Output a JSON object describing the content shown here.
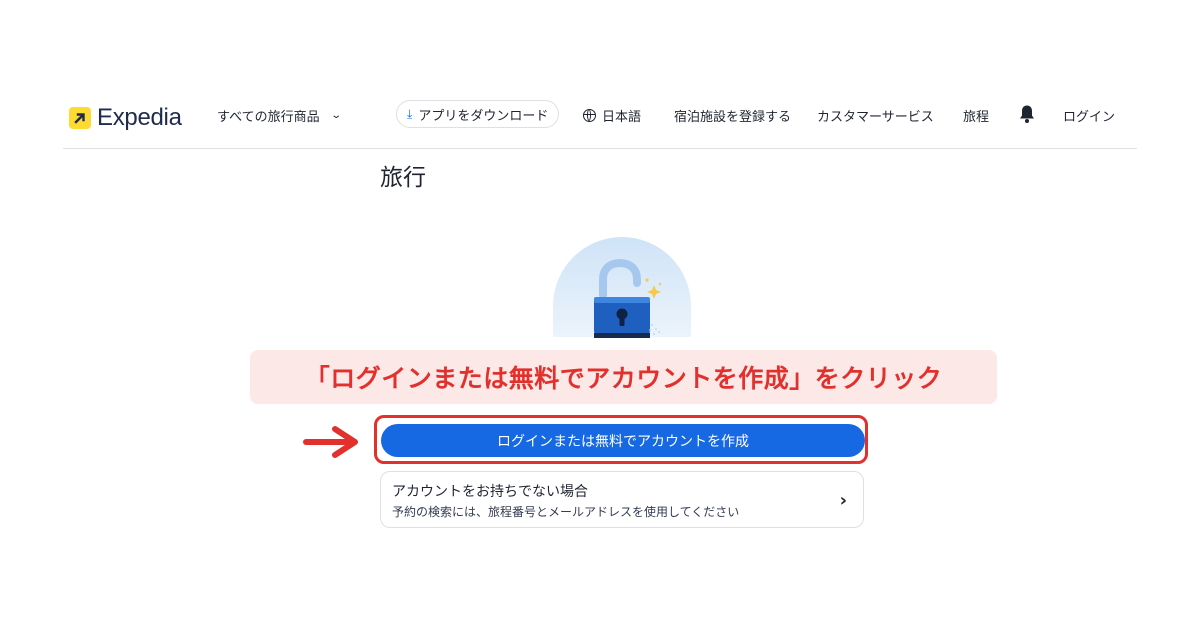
{
  "header": {
    "logo_text": "Expedia",
    "all_products": "すべての旅行商品",
    "app_download": "アプリをダウンロード",
    "language": "日本語",
    "register_property": "宿泊施設を登録する",
    "customer_service": "カスタマーサービス",
    "trips": "旅程",
    "login": "ログイン",
    "icons": {
      "logo": "expedia-arrow-icon",
      "chevron": "chevron-down-icon",
      "download": "download-icon",
      "globe": "globe-icon",
      "bell": "bell-icon"
    }
  },
  "main": {
    "heading": "旅行",
    "illustration": "unlocked-padlock-icon",
    "primary_button": "ログインまたは無料でアカウントを作成",
    "no_account": {
      "title": "アカウントをお持ちでない場合",
      "subtitle": "予約の検索には、旅程番号とメールアドレスを使用してください"
    }
  },
  "annotation": {
    "banner_text": "「ログインまたは無料でアカウントを作成」をクリック",
    "arrow": "right-arrow-icon"
  },
  "colors": {
    "accent_blue": "#1668e3",
    "brand_yellow": "#fddb32",
    "annotation_red": "#e2302d",
    "annotation_bg": "#fde8e8",
    "text_dark": "#1f2430"
  }
}
